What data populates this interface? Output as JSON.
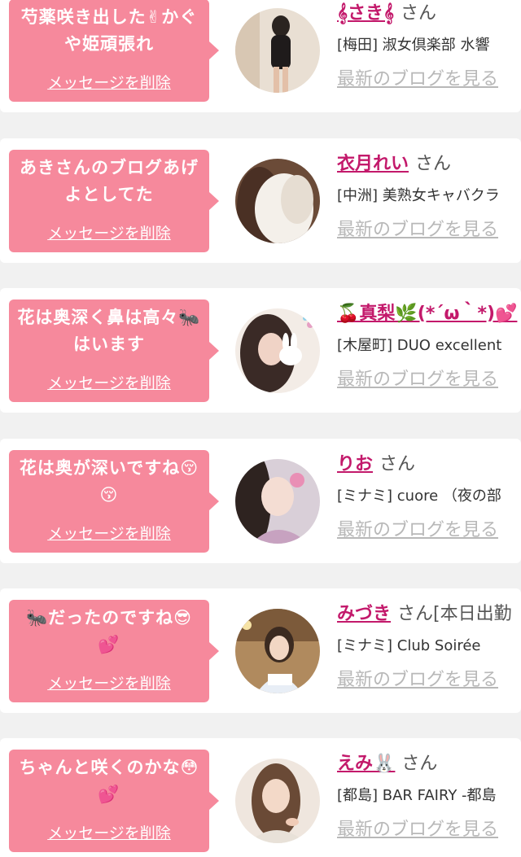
{
  "delete_label": "メッセージを削除",
  "blog_label": "最新のブログを見る",
  "honorific": "さん",
  "items": [
    {
      "message": "芍薬咲き出した✌かぐや姫頑張れ",
      "name": "𝄞さき𝄞",
      "shop": "[梅田] 淑女倶楽部 水響",
      "avatar": "avatar-photo"
    },
    {
      "message": "あきさんのブログあげよとしてた",
      "name": "衣月れい",
      "shop": "[中洲] 美熟女キャバクラ",
      "avatar": "avatar-photo"
    },
    {
      "message": "花は奥深く鼻は高々🐜はいます",
      "name": "🍒真梨🌿(*´ω｀*)💕",
      "shop": "[木屋町] DUO excellent",
      "avatar": "avatar-photo"
    },
    {
      "message": "花は奥が深いですね😚😚",
      "name": "りお",
      "shop": "[ミナミ] cuore （夜の部",
      "avatar": "avatar-photo"
    },
    {
      "message": "🐜だったのですね😎💕",
      "name": "みづき",
      "name_suffix": "さん[本日出勤",
      "shop": "[ミナミ] Club Soirée",
      "avatar": "avatar-photo"
    },
    {
      "message": "ちゃんと咲くのかな😳💕",
      "name": "えみ🐰",
      "shop": "[都島] BAR FAIRY -都島",
      "avatar": "avatar-photo"
    }
  ],
  "colors": {
    "bubble": "#f6899c",
    "name": "#c3196b",
    "link_gray": "#b8b8b8",
    "background": "#f1f1f1"
  }
}
